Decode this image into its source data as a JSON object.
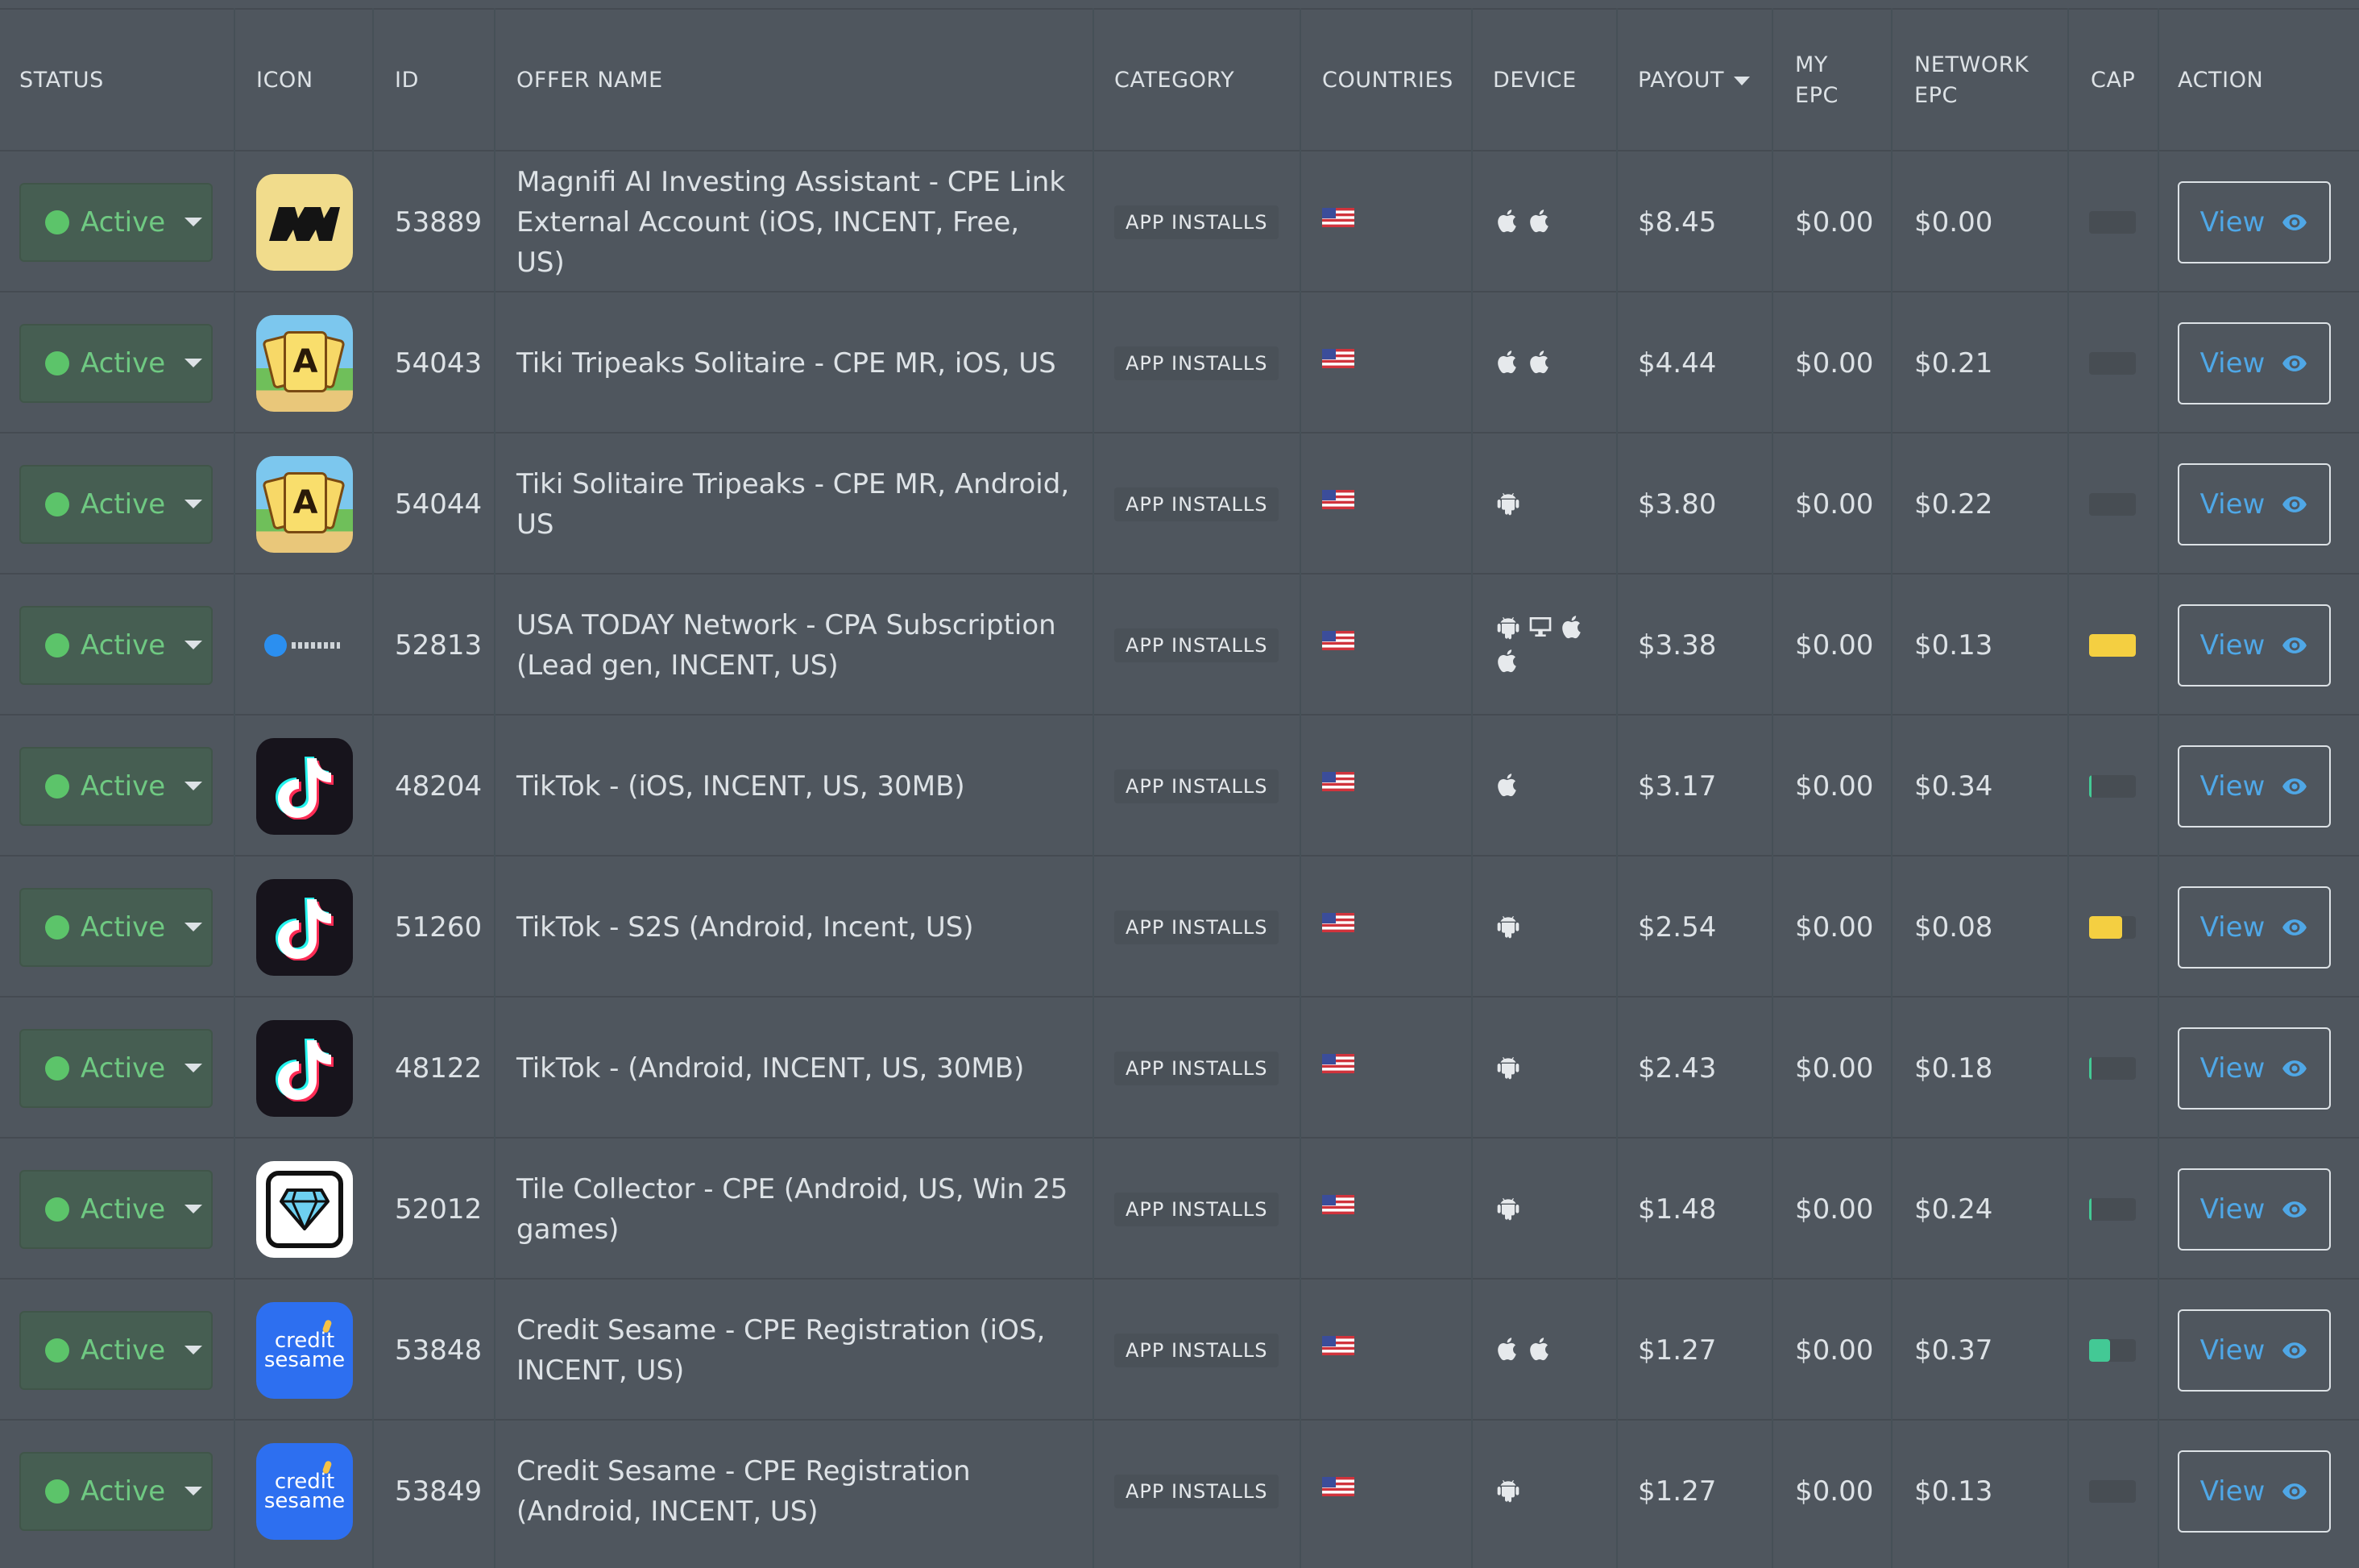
{
  "headers": {
    "status": "STATUS",
    "icon": "ICON",
    "id": "ID",
    "offer_name": "OFFER NAME",
    "category": "CATEGORY",
    "countries": "COUNTRIES",
    "device": "DEVICE",
    "payout": "PAYOUT",
    "my_epc": "MY EPC",
    "network_epc": "NETWORK EPC",
    "cap": "CAP",
    "action": "ACTION"
  },
  "colors": {
    "status_green": "#5cc46a",
    "view_blue": "#4fa7e6",
    "cap_yellow": "#f4cf41",
    "cap_green": "#43c995"
  },
  "rows": [
    {
      "status": "Active",
      "icon": "magnifi-icon",
      "id": "53889",
      "name": "Magnifi AI Investing Assistant - CPE Link External Account (iOS, INCENT, Free, US)",
      "category": "APP INSTALLS",
      "country": "US",
      "devices": [
        "apple",
        "apple"
      ],
      "payout": "$8.45",
      "my_epc": "$0.00",
      "network_epc": "$0.00",
      "cap_level": 0,
      "cap_color": "",
      "action": "View"
    },
    {
      "status": "Active",
      "icon": "tiki-solitaire-icon",
      "id": "54043",
      "name": "Tiki Tripeaks Solitaire - CPE MR, iOS, US",
      "category": "APP INSTALLS",
      "country": "US",
      "devices": [
        "apple",
        "apple"
      ],
      "payout": "$4.44",
      "my_epc": "$0.00",
      "network_epc": "$0.21",
      "cap_level": 0,
      "cap_color": "",
      "action": "View"
    },
    {
      "status": "Active",
      "icon": "tiki-solitaire-icon",
      "id": "54044",
      "name": "Tiki Solitaire Tripeaks - CPE MR, Android, US",
      "category": "APP INSTALLS",
      "country": "US",
      "devices": [
        "android"
      ],
      "payout": "$3.80",
      "my_epc": "$0.00",
      "network_epc": "$0.22",
      "cap_level": 0,
      "cap_color": "",
      "action": "View"
    },
    {
      "status": "Active",
      "icon": "usa-today-icon",
      "id": "52813",
      "name": "USA TODAY Network - CPA Subscription (Lead gen, INCENT, US)",
      "category": "APP INSTALLS",
      "country": "US",
      "devices": [
        "android",
        "desktop",
        "apple",
        "apple"
      ],
      "payout": "$3.38",
      "my_epc": "$0.00",
      "network_epc": "$0.13",
      "cap_level": 1.0,
      "cap_color": "#f4cf41",
      "action": "View"
    },
    {
      "status": "Active",
      "icon": "tiktok-icon",
      "id": "48204",
      "name": "TikTok - (iOS, INCENT, US, 30MB)",
      "category": "APP INSTALLS",
      "country": "US",
      "devices": [
        "apple"
      ],
      "payout": "$3.17",
      "my_epc": "$0.00",
      "network_epc": "$0.34",
      "cap_level": 0.06,
      "cap_color": "#43c995",
      "action": "View"
    },
    {
      "status": "Active",
      "icon": "tiktok-icon",
      "id": "51260",
      "name": "TikTok - S2S (Android, Incent, US)",
      "category": "APP INSTALLS",
      "country": "US",
      "devices": [
        "android"
      ],
      "payout": "$2.54",
      "my_epc": "$0.00",
      "network_epc": "$0.08",
      "cap_level": 0.7,
      "cap_color": "#f4cf41",
      "action": "View"
    },
    {
      "status": "Active",
      "icon": "tiktok-icon",
      "id": "48122",
      "name": "TikTok - (Android, INCENT, US, 30MB)",
      "category": "APP INSTALLS",
      "country": "US",
      "devices": [
        "android"
      ],
      "payout": "$2.43",
      "my_epc": "$0.00",
      "network_epc": "$0.18",
      "cap_level": 0.06,
      "cap_color": "#43c995",
      "action": "View"
    },
    {
      "status": "Active",
      "icon": "tile-collector-icon",
      "id": "52012",
      "name": "Tile Collector - CPE (Android, US, Win 25 games)",
      "category": "APP INSTALLS",
      "country": "US",
      "devices": [
        "android"
      ],
      "payout": "$1.48",
      "my_epc": "$0.00",
      "network_epc": "$0.24",
      "cap_level": 0.06,
      "cap_color": "#43c995",
      "action": "View"
    },
    {
      "status": "Active",
      "icon": "credit-sesame-icon",
      "id": "53848",
      "name": "Credit Sesame - CPE Registration (iOS, INCENT, US)",
      "category": "APP INSTALLS",
      "country": "US",
      "devices": [
        "apple",
        "apple"
      ],
      "payout": "$1.27",
      "my_epc": "$0.00",
      "network_epc": "$0.37",
      "cap_level": 0.45,
      "cap_color": "#43c995",
      "action": "View"
    },
    {
      "status": "Active",
      "icon": "credit-sesame-icon",
      "id": "53849",
      "name": "Credit Sesame - CPE Registration (Android, INCENT, US)",
      "category": "APP INSTALLS",
      "country": "US",
      "devices": [
        "android"
      ],
      "payout": "$1.27",
      "my_epc": "$0.00",
      "network_epc": "$0.13",
      "cap_level": 0,
      "cap_color": "",
      "action": "View"
    }
  ],
  "icon_text": {
    "credit_line1": "credit",
    "credit_line2": "sesame"
  }
}
